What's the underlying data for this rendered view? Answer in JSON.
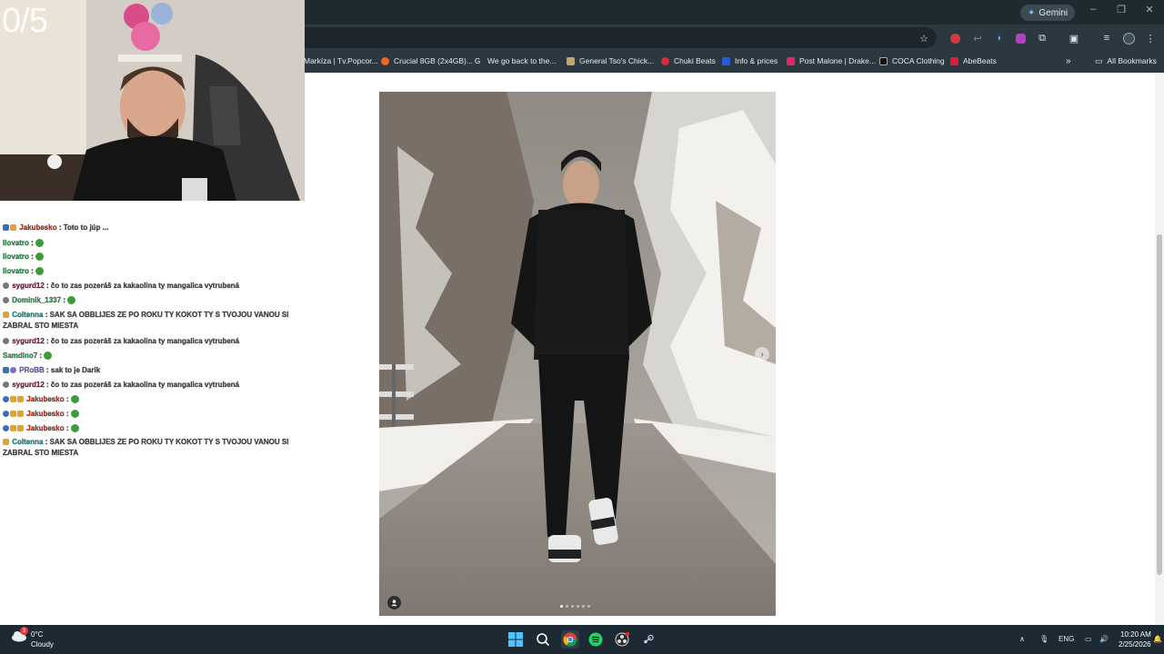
{
  "overlay": {
    "counter": "0/5"
  },
  "browser": {
    "gemini_label": "Gemini",
    "bookmarks": [
      {
        "label": "Markíza | Tv.Popcor...",
        "color": "#e4572e"
      },
      {
        "label": "Crucial 8GB (2x4GB)...",
        "color": "#f26522"
      },
      {
        "label": "We go back to the...",
        "color": "#ffffff"
      },
      {
        "label": "General Tso's Chick...",
        "color": "#c8a464"
      },
      {
        "label": "Chuki Beats",
        "color": "#d62b3a"
      },
      {
        "label": "Info & prices",
        "color": "#2a5bd7"
      },
      {
        "label": "Post Malone | Drake...",
        "color": "#e8226b"
      },
      {
        "label": "COCA Clothing",
        "color": "#111111"
      },
      {
        "label": "AbeBeats",
        "color": "#e21c34"
      }
    ],
    "all_bookmarks": "All Bookmarks"
  },
  "chat": {
    "lines": [
      {
        "user": "Jakubesko",
        "text": ": Toto to júp ...",
        "color": "#c0392b"
      },
      {
        "user": "Ilovatro",
        "text": ":",
        "color": "#2fa84f",
        "emote": true
      },
      {
        "user": "Ilovatro",
        "text": ":",
        "color": "#2fa84f",
        "emote": true
      },
      {
        "user": "Ilovatro",
        "text": ":",
        "color": "#2fa84f",
        "emote": true
      },
      {
        "user": "sygurd12",
        "text": ": čo to zas pozeráš za kakaolina ty mangalica vytrubená",
        "color": "#9b1c52"
      },
      {
        "user": "Dominik_1337",
        "text": ":",
        "color": "#2fa84f",
        "emote": true
      },
      {
        "user": "Coltenna",
        "text": ": SAK SA OBBLIJES ZE PO ROKU TY KOKOT TY S TVOJOU VANOU SI ZABRAL STO MIESTA",
        "color": "#1f9f9a"
      },
      {
        "user": "sygurd12",
        "text": ": čo to zas pozeráš za kakaolina ty mangalica vytrubená",
        "color": "#9b1c52"
      },
      {
        "user": "Samdino7",
        "text": ":",
        "color": "#2fa84f",
        "emote": true
      },
      {
        "user": "PRoBB",
        "text": ": sak to je Darik",
        "color": "#7a6fd0"
      },
      {
        "user": "sygurd12",
        "text": ": čo to zas pozeráš za kakaolina ty mangalica vytrubená",
        "color": "#9b1c52"
      },
      {
        "user": "Jakubesko",
        "text": ":",
        "color": "#c0392b",
        "emote": true
      },
      {
        "user": "Jakubesko",
        "text": ":",
        "color": "#c0392b",
        "emote": true
      },
      {
        "user": "Jakubesko",
        "text": ":",
        "color": "#c0392b",
        "emote": true
      },
      {
        "user": "Coltenna",
        "text": ": SAK SA OBBLIJES ZE PO ROKU TY KOKOT TY S TVOJOU VANOU SI ZABRAL STO MIESTA",
        "color": "#1f9f9a"
      }
    ]
  },
  "taskbar": {
    "weather_temp": "0°C",
    "weather_cond": "Cloudy",
    "weather_badge": "3",
    "lang": "ENG",
    "time": "10:20 AM",
    "date": "2/25/2026"
  }
}
